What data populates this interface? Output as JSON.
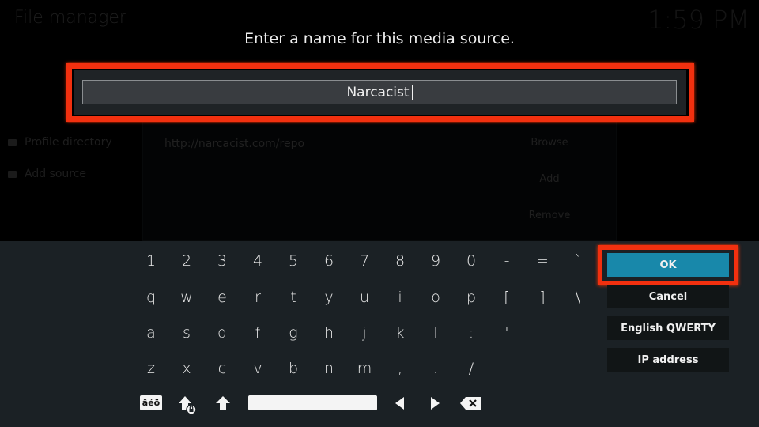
{
  "background": {
    "title": "File manager",
    "clock": "1:59 PM",
    "sidebar": [
      {
        "icon": "folder-icon",
        "label": "Profile directory"
      },
      {
        "icon": "folder-icon",
        "label": "Add source"
      }
    ],
    "dialog": {
      "url": "http://narcacist.com/repo",
      "buttons": [
        "Browse",
        "Add",
        "Remove"
      ]
    }
  },
  "prompt": "Enter a name for this media source.",
  "input": {
    "value": "Narcacist"
  },
  "keyboard": {
    "rows": [
      [
        "1",
        "2",
        "3",
        "4",
        "5",
        "6",
        "7",
        "8",
        "9",
        "0",
        "-",
        "=",
        "`"
      ],
      [
        "q",
        "w",
        "e",
        "r",
        "t",
        "y",
        "u",
        "i",
        "o",
        "p",
        "[",
        "]",
        "\\"
      ],
      [
        "a",
        "s",
        "d",
        "f",
        "g",
        "h",
        "j",
        "k",
        "l",
        ":",
        "'"
      ],
      [
        "z",
        "x",
        "c",
        "v",
        "b",
        "n",
        "m",
        ",",
        ".",
        "/"
      ]
    ],
    "accent_label": "âéö",
    "special_keys": [
      "accented-characters",
      "caps-lock",
      "shift",
      "space",
      "cursor-left",
      "cursor-right",
      "backspace"
    ]
  },
  "side_buttons": {
    "ok": "OK",
    "cancel": "Cancel",
    "layout": "English QWERTY",
    "ip": "IP address"
  },
  "colors": {
    "highlight": "#f2300f",
    "ok_button": "#1888aa",
    "keyboard_bg": "#1b2125"
  }
}
